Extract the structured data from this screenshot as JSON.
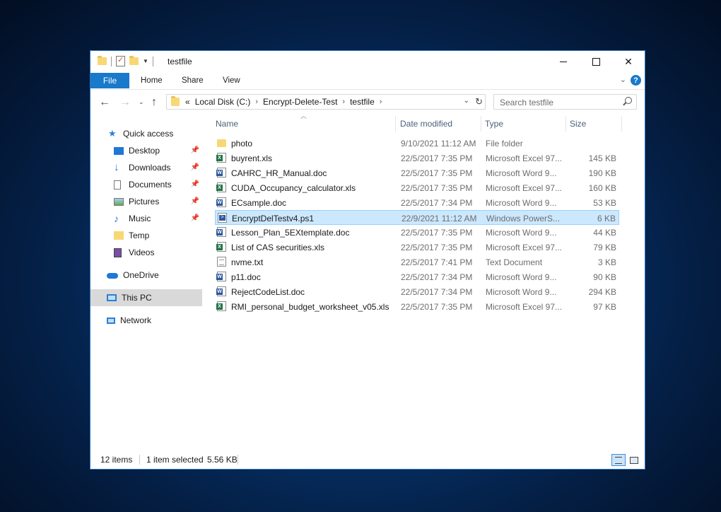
{
  "window": {
    "title": "testfile"
  },
  "ribbon": {
    "file": "File",
    "home": "Home",
    "share": "Share",
    "view": "View"
  },
  "address": {
    "prefix": "«",
    "crumbs": [
      "Local Disk (C:)",
      "Encrypt-Delete-Test",
      "testfile"
    ]
  },
  "search": {
    "placeholder": "Search testfile"
  },
  "nav": {
    "quick_access": "Quick access",
    "desktop": "Desktop",
    "downloads": "Downloads",
    "documents": "Documents",
    "pictures": "Pictures",
    "music": "Music",
    "temp": "Temp",
    "videos": "Videos",
    "onedrive": "OneDrive",
    "this_pc": "This PC",
    "network": "Network"
  },
  "columns": {
    "name": "Name",
    "date": "Date modified",
    "type": "Type",
    "size": "Size"
  },
  "files": [
    {
      "name": "photo",
      "date": "9/10/2021 11:12 AM",
      "type": "File folder",
      "size": "",
      "icon": "folder-icon"
    },
    {
      "name": "buyrent.xls",
      "date": "22/5/2017 7:35 PM",
      "type": "Microsoft Excel 97...",
      "size": "145 KB",
      "icon": "excel-file-icon"
    },
    {
      "name": "CAHRC_HR_Manual.doc",
      "date": "22/5/2017 7:35 PM",
      "type": "Microsoft Word 9...",
      "size": "190 KB",
      "icon": "word-file-icon"
    },
    {
      "name": "CUDA_Occupancy_calculator.xls",
      "date": "22/5/2017 7:35 PM",
      "type": "Microsoft Excel 97...",
      "size": "160 KB",
      "icon": "excel-file-icon"
    },
    {
      "name": "ECsample.doc",
      "date": "22/5/2017 7:34 PM",
      "type": "Microsoft Word 9...",
      "size": "53 KB",
      "icon": "word-file-icon"
    },
    {
      "name": "EncryptDelTestv4.ps1",
      "date": "22/9/2021 11:12 AM",
      "type": "Windows PowerS...",
      "size": "6 KB",
      "icon": "powershell-file-icon",
      "selected": true
    },
    {
      "name": "Lesson_Plan_5EXtemplate.doc",
      "date": "22/5/2017 7:35 PM",
      "type": "Microsoft Word 9...",
      "size": "44 KB",
      "icon": "word-file-icon"
    },
    {
      "name": "List of CAS securities.xls",
      "date": "22/5/2017 7:35 PM",
      "type": "Microsoft Excel 97...",
      "size": "79 KB",
      "icon": "excel-file-icon"
    },
    {
      "name": "nvme.txt",
      "date": "22/5/2017 7:41 PM",
      "type": "Text Document",
      "size": "3 KB",
      "icon": "text-file-icon"
    },
    {
      "name": "p11.doc",
      "date": "22/5/2017 7:34 PM",
      "type": "Microsoft Word 9...",
      "size": "90 KB",
      "icon": "word-file-icon"
    },
    {
      "name": "RejectCodeList.doc",
      "date": "22/5/2017 7:34 PM",
      "type": "Microsoft Word 9...",
      "size": "294 KB",
      "icon": "word-file-icon"
    },
    {
      "name": "RMI_personal_budget_worksheet_v05.xls",
      "date": "22/5/2017 7:35 PM",
      "type": "Microsoft Excel 97...",
      "size": "97 KB",
      "icon": "excel-file-icon"
    }
  ],
  "status": {
    "items": "12 items",
    "selected": "1 item selected",
    "size": "5.56 KB"
  },
  "colors": {
    "accent": "#1979ca",
    "selection": "#cce8ff",
    "selection_border": "#99d1ff"
  }
}
